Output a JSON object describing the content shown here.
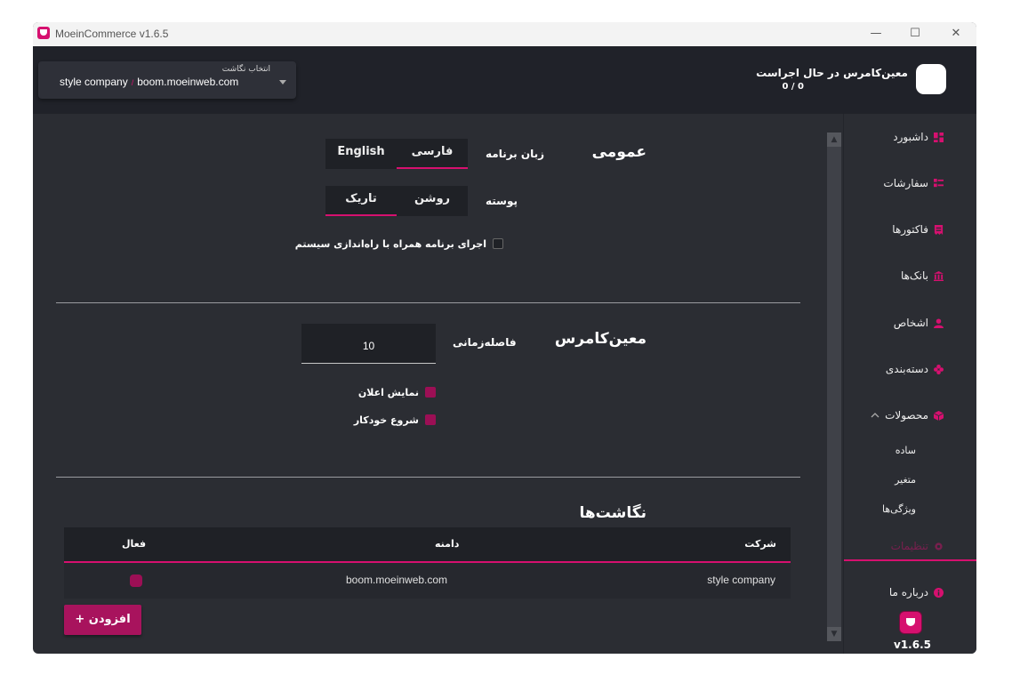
{
  "window": {
    "title": "MoeinCommerce v1.6.5",
    "minimize": "—",
    "maximize": "☐",
    "close": "✕"
  },
  "header": {
    "company_select": {
      "label": "انتخاب نگاشت",
      "company": "style company",
      "separator": "/",
      "domain": "boom.moeinweb.com"
    },
    "status": {
      "title": "معین‌کامرس در حال اجراست",
      "count": "0 / 0"
    }
  },
  "sidebar": {
    "items": [
      {
        "label": "داشبورد",
        "icon": "dashboard-icon"
      },
      {
        "label": "سفارشات",
        "icon": "orders-icon"
      },
      {
        "label": "فاکتورها",
        "icon": "invoice-icon"
      },
      {
        "label": "بانک‌ها",
        "icon": "bank-icon"
      },
      {
        "label": "اشخاص",
        "icon": "person-icon"
      },
      {
        "label": "دسته‌بندی",
        "icon": "category-icon"
      },
      {
        "label": "محصولات",
        "icon": "product-icon"
      }
    ],
    "sub_items": [
      "ساده",
      "متغیر",
      "ویژگی‌ها"
    ],
    "settings": {
      "label": "تنظیمات",
      "icon": "gear-icon"
    },
    "about": {
      "label": "درباره ما",
      "icon": "info-icon"
    },
    "version": "v1.6.5"
  },
  "main": {
    "general": {
      "title": "عمومی",
      "language_label": "زبان برنامه",
      "language_options": [
        "English",
        "فارسی"
      ],
      "language_selected": "فارسی",
      "skin_label": "پوسته",
      "skin_options": [
        "تاریک",
        "روشن"
      ],
      "skin_selected": "تاریک",
      "startup_label": "اجرای برنامه همراه با راه‌اندازی سیستم",
      "startup_checked": false
    },
    "moein": {
      "title": "معین‌کامرس",
      "interval_label": "فاصله‌زمانی",
      "interval_value": "10",
      "show_notification_label": "نمایش اعلان",
      "show_notification_checked": true,
      "auto_start_label": "شروع خودکار",
      "auto_start_checked": true
    },
    "mappings": {
      "title": "نگاشت‌ها",
      "columns": {
        "active": "فعال",
        "domain": "دامنه",
        "company": "شرکت"
      },
      "rows": [
        {
          "active": true,
          "domain": "boom.moeinweb.com",
          "company": "style company"
        }
      ],
      "add_button": "+ افزودن"
    }
  },
  "colors": {
    "accent": "#d6106f",
    "background": "#2b2d33",
    "header": "#202229"
  }
}
